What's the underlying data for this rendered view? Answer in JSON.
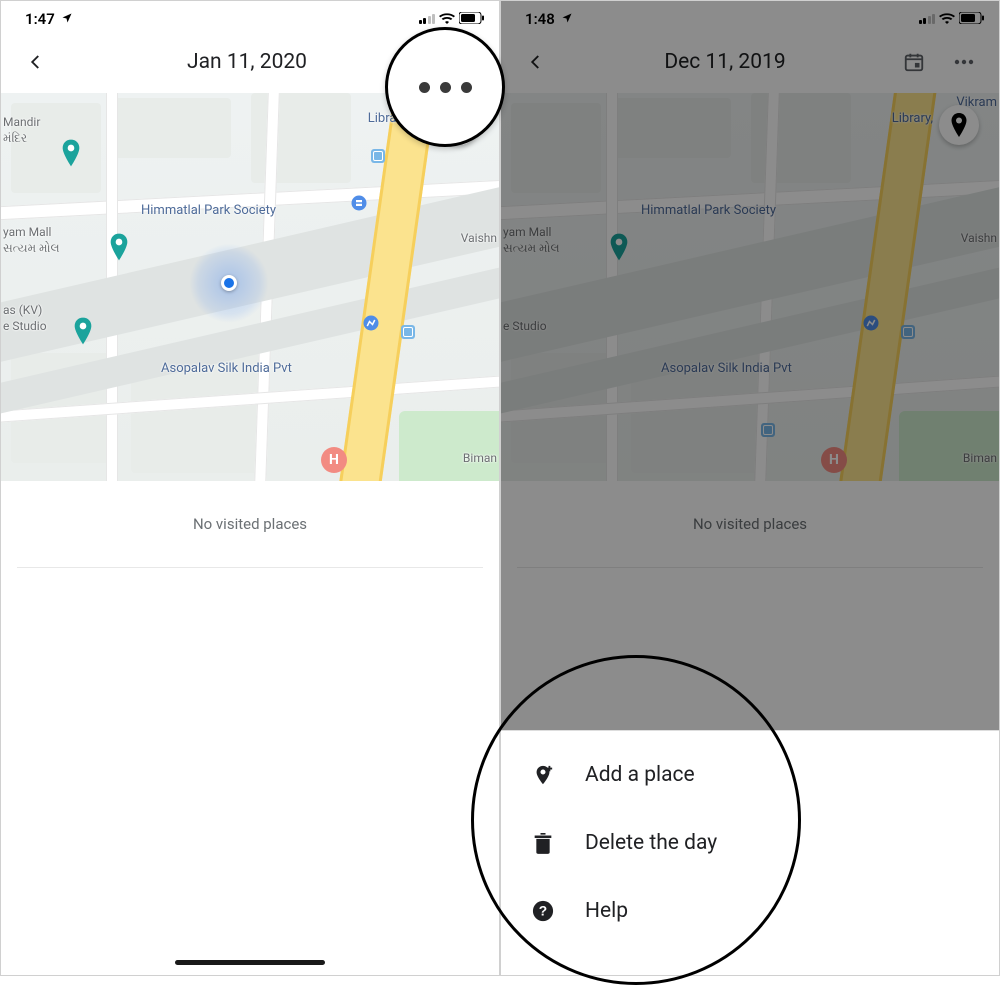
{
  "left": {
    "status": {
      "time": "1:47",
      "location_icon": "loc-arrow"
    },
    "header": {
      "title": "Jan 11, 2020"
    },
    "map": {
      "labels": {
        "library": "Library,",
        "park_society": "Himmatlal Park Society",
        "silk": "Asopalav Silk India Pvt",
        "mandir": "Mandir",
        "mandir_gu": "મંદિર",
        "mall": "yam Mall",
        "mall_gu": "સત્યમ મોલ",
        "studio1": "as (KV)",
        "studio2": "e Studio",
        "vaishn": "Vaishn",
        "biman": "Biman",
        "vikram": "Vikram"
      }
    },
    "no_visited": "No visited places"
  },
  "right": {
    "status": {
      "time": "1:48",
      "location_icon": "loc-arrow"
    },
    "header": {
      "title": "Dec 11, 2019"
    },
    "no_visited": "No visited places",
    "sheet": {
      "add": "Add a place",
      "delete": "Delete the day",
      "help": "Help"
    }
  }
}
